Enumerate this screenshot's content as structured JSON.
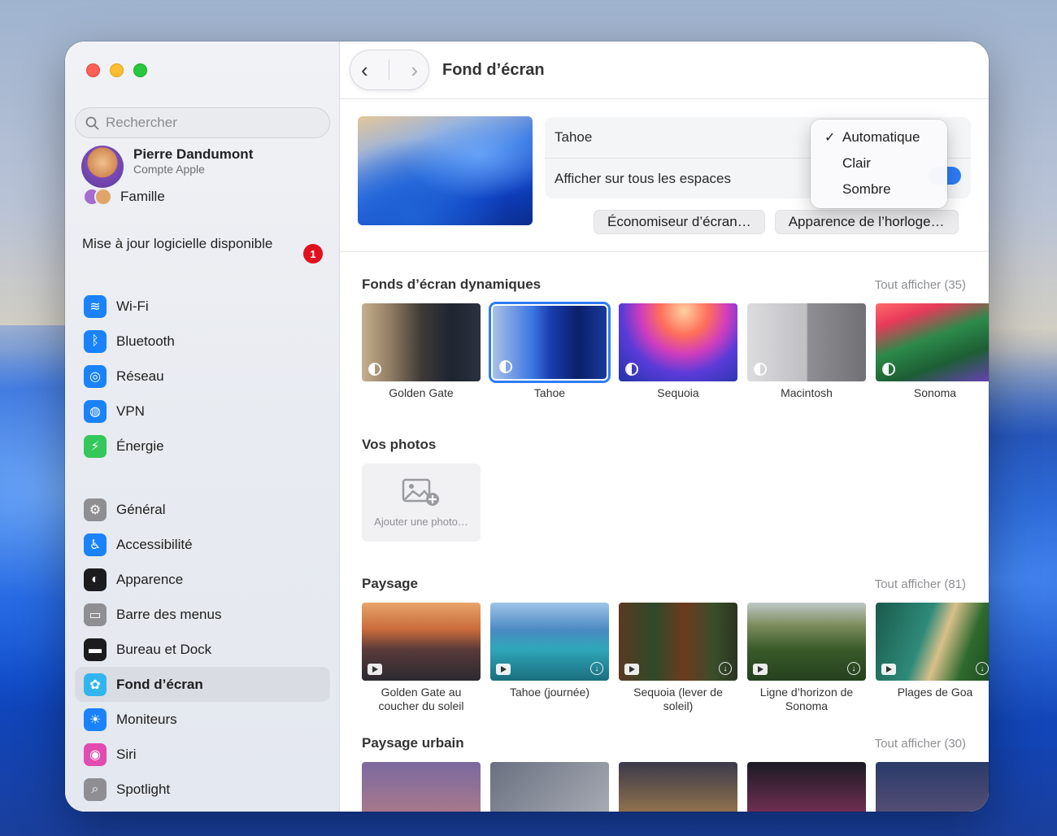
{
  "sidebar": {
    "search_placeholder": "Rechercher",
    "account": {
      "name": "Pierre Dandumont",
      "subtitle": "Compte Apple"
    },
    "family": "Famille",
    "update": {
      "text": "Mise à jour logicielle disponible",
      "badge": "1"
    },
    "group1": [
      {
        "label": "Wi-Fi",
        "icon": "wifi-icon",
        "color": "#1a82fb"
      },
      {
        "label": "Bluetooth",
        "icon": "bluetooth-icon",
        "color": "#1a82fb"
      },
      {
        "label": "Réseau",
        "icon": "globe-icon",
        "color": "#1a82fb"
      },
      {
        "label": "VPN",
        "icon": "vpn-globe-icon",
        "color": "#1a82fb"
      },
      {
        "label": "Énergie",
        "icon": "bolt-icon",
        "color": "#34c759"
      }
    ],
    "group2": [
      {
        "label": "Général",
        "icon": "gear-icon",
        "color": "#8e8e93"
      },
      {
        "label": "Accessibilité",
        "icon": "accessibility-icon",
        "color": "#1a82fb"
      },
      {
        "label": "Apparence",
        "icon": "appearance-icon",
        "color": "#1c1c1e"
      },
      {
        "label": "Barre des menus",
        "icon": "menubar-icon",
        "color": "#8e8e93"
      },
      {
        "label": "Bureau et Dock",
        "icon": "dock-icon",
        "color": "#1c1c1e"
      },
      {
        "label": "Fond d’écran",
        "icon": "wallpaper-icon",
        "color": "#31b5ef",
        "selected": true
      },
      {
        "label": "Moniteurs",
        "icon": "display-icon",
        "color": "#1a82fb"
      },
      {
        "label": "Siri",
        "icon": "siri-icon",
        "color": "#e24bb0"
      },
      {
        "label": "Spotlight",
        "icon": "spotlight-icon",
        "color": "#8e8e93"
      }
    ]
  },
  "toolbar": {
    "back": "‹",
    "forward": "›",
    "title": "Fond d’écran"
  },
  "current": {
    "name": "Tahoe",
    "show_all_spaces": "Afficher sur tous les espaces",
    "toggle_on": true,
    "screensaver_button": "Économiseur d’écran…",
    "clock_button": "Apparence de l’horloge…"
  },
  "dropdown": {
    "options": [
      "Automatique",
      "Clair",
      "Sombre"
    ],
    "selected": "Automatique"
  },
  "dynamic": {
    "title": "Fonds d’écran dynamiques",
    "show_all": "Tout afficher (35)",
    "items": [
      {
        "label": "Golden Gate"
      },
      {
        "label": "Tahoe",
        "selected": true
      },
      {
        "label": "Sequoia"
      },
      {
        "label": "Macintosh"
      },
      {
        "label": "Sonoma"
      }
    ]
  },
  "photos": {
    "title": "Vos photos",
    "add_label": "Ajouter une photo…"
  },
  "landscape": {
    "title": "Paysage",
    "show_all": "Tout afficher (81)",
    "items": [
      {
        "label": "Golden Gate au coucher du soleil"
      },
      {
        "label": "Tahoe (journée)"
      },
      {
        "label": "Sequoia (lever de soleil)"
      },
      {
        "label": "Ligne d’horizon de Sonoma"
      },
      {
        "label": "Plages de Goa"
      }
    ]
  },
  "urban": {
    "title": "Paysage urbain",
    "show_all": "Tout afficher (30)"
  }
}
